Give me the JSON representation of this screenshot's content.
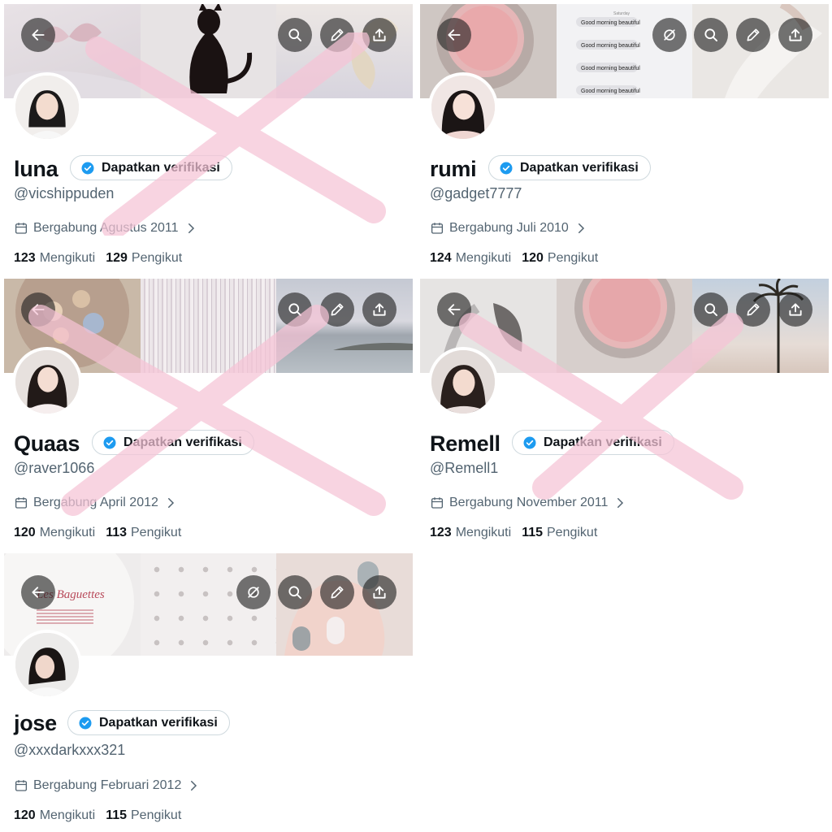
{
  "verify_label": "Dapatkan verifikasi",
  "following_label": "Mengikuti",
  "followers_label": "Pengikut",
  "icons": {
    "back": "arrow-left-icon",
    "search": "search-icon",
    "edit": "pencil-icon",
    "share": "share-icon",
    "hide": "eye-off-icon",
    "calendar": "calendar-icon",
    "verified": "verified-badge-icon"
  },
  "cross_color": "#f5c3d6",
  "profiles": [
    {
      "name": "luna",
      "handle": "@vicshippuden",
      "joined": "Bergabung Agustus 2011",
      "following": "123",
      "followers": "129",
      "crossed": true
    },
    {
      "name": "rumi",
      "handle": "@gadget7777",
      "joined": "Bergabung Juli 2010",
      "following": "124",
      "followers": "120",
      "crossed": false,
      "chat_lines": [
        "Good morning beautiful",
        "Good morning beautiful",
        "Good morning beautiful",
        "Good morning beautiful"
      ]
    },
    {
      "name": "Quaas",
      "handle": "@raver1066",
      "joined": "Bergabung April 2012",
      "following": "120",
      "followers": "113",
      "crossed": true
    },
    {
      "name": "Remell",
      "handle": "@Remell1",
      "joined": "Bergabung November 2011",
      "following": "123",
      "followers": "115",
      "crossed": true
    },
    {
      "name": "jose",
      "handle": "@xxxdarkxxx321",
      "joined": "Bergabung Februari 2012",
      "following": "120",
      "followers": "115",
      "crossed": false,
      "banner_text": "Les Baguettes"
    }
  ]
}
